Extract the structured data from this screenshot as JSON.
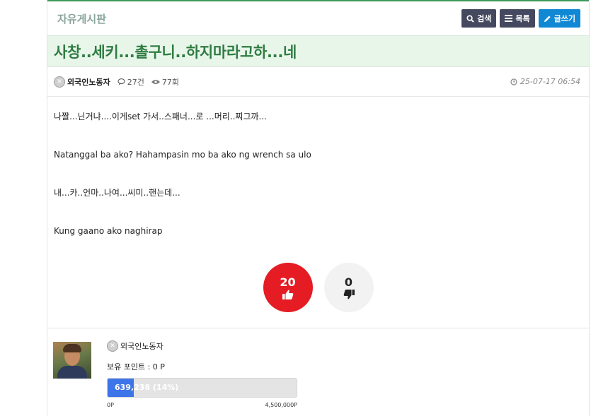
{
  "board": {
    "name": "자유게시판"
  },
  "toolbar": {
    "search_label": "검색",
    "list_label": "목록",
    "write_label": "글쓰기"
  },
  "post": {
    "title": "사창..세키...촐구니..하지마라고하...네",
    "author": "외국인노동자",
    "comments": "27건",
    "views": "77회",
    "date": "25-07-17 06:54",
    "paragraphs": [
      "나짤...닌거냐....이게set 가서..스패너...로 ...머리..찌그까...",
      "Natanggal ba ako? Hahampasin mo ba ako ng wrench sa ulo",
      "내...카..언마..나여...씨미..핸는데...",
      "Kung gaano ako naghirap"
    ],
    "likes": "20",
    "dislikes": "0"
  },
  "profile": {
    "name": "외국인노동자",
    "points_label": "보유 포인트 : 0 P",
    "progress_text": "639,238 (14%)",
    "progress_percent": 14,
    "min_label": "0P",
    "max_label": "4,500,000P"
  },
  "colors": {
    "accent": "#3d9a5a",
    "title_bg": "#e8f6ea",
    "like": "#e51c23",
    "write_btn": "#1188d4",
    "progress": "#3d74e8"
  }
}
